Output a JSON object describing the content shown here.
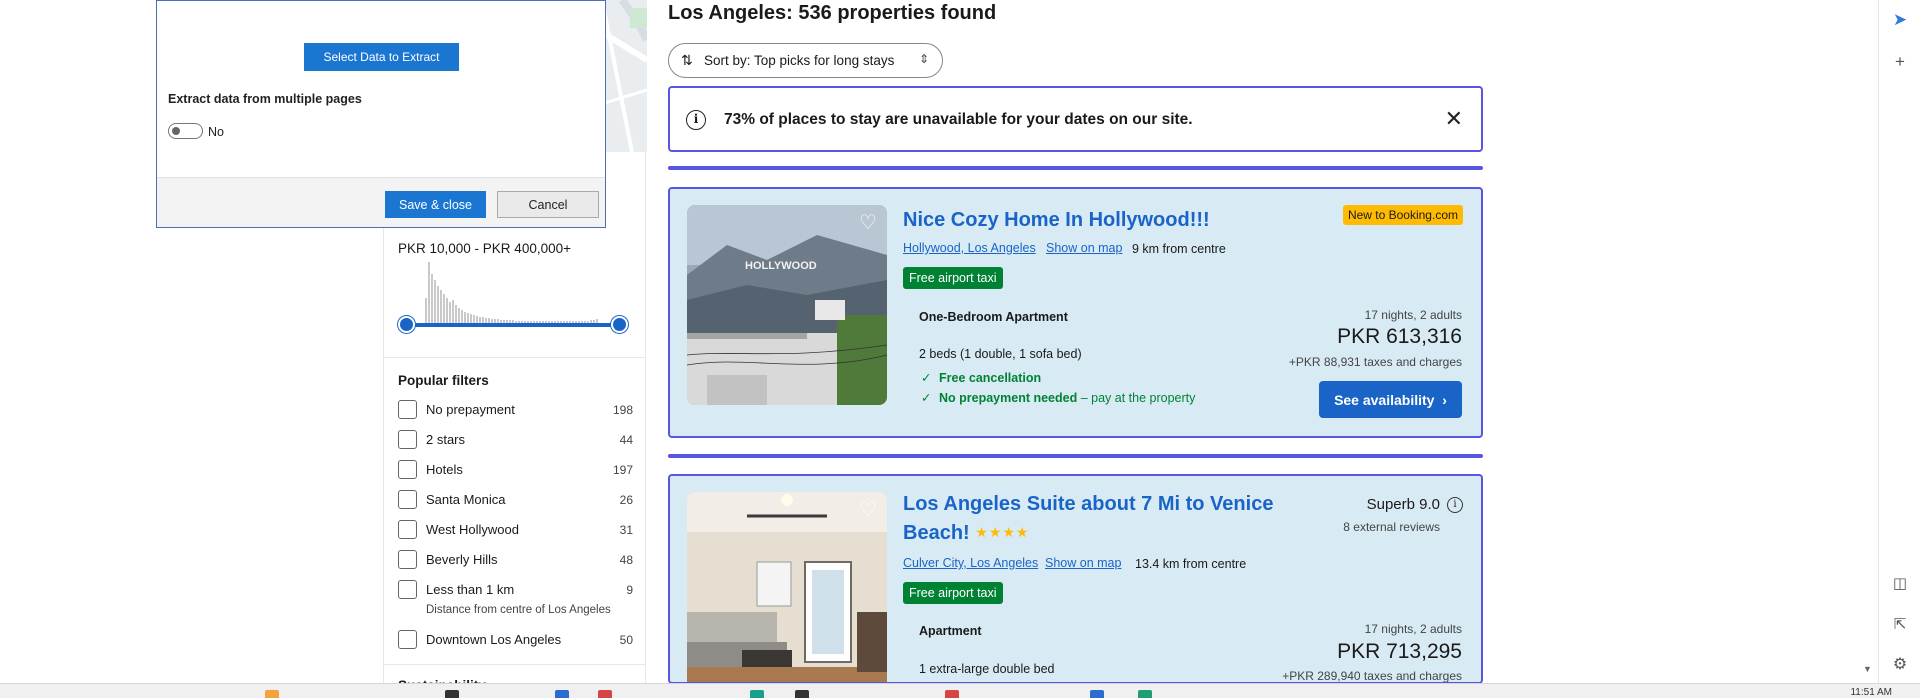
{
  "dialog": {
    "select_button": "Select Data to Extract",
    "multi_page_label": "Extract data from multiple pages",
    "toggle_label": "No",
    "toggle_on": false,
    "save_button": "Save & close",
    "cancel_button": "Cancel"
  },
  "filters": {
    "price_range": "PKR 10,000 - PKR 400,000+",
    "popular_title": "Popular filters",
    "items": [
      {
        "label": "No prepayment",
        "count": "198"
      },
      {
        "label": "2 stars",
        "count": "44"
      },
      {
        "label": "Hotels",
        "count": "197"
      },
      {
        "label": "Santa Monica",
        "count": "26"
      },
      {
        "label": "West Hollywood",
        "count": "31"
      },
      {
        "label": "Beverly Hills",
        "count": "48"
      },
      {
        "label": "Less than 1 km",
        "count": "9",
        "sub": "Distance from centre of Los Angeles"
      },
      {
        "label": "Downtown Los Angeles",
        "count": "50"
      }
    ],
    "next_section_title": "Sustainability"
  },
  "results": {
    "title": "Los Angeles: 536 properties found",
    "sort_label": "Sort by: Top picks for long stays",
    "notice": "73% of places to stay are unavailable for your dates on our site."
  },
  "listings": [
    {
      "name": "Nice Cozy Home In Hollywood!!!",
      "badge": "New to Booking.com",
      "location": "Hollywood, Los Angeles",
      "map_link": "Show on map",
      "distance": "9 km from centre",
      "taxi": "Free airport taxi",
      "unit_type": "One-Bedroom Apartment",
      "beds": "2 beds (1 double, 1 sofa bed)",
      "perk1": "Free cancellation",
      "perk2_bold": "No prepayment needed",
      "perk2_rest": " – pay at the property",
      "stay": "17 nights, 2 adults",
      "price": "PKR 613,316",
      "taxes": "+PKR 88,931 taxes and charges",
      "cta": "See availability"
    },
    {
      "name_line1": "Los Angeles Suite about 7 Mi to Venice",
      "name_line2": "Beach!",
      "stars": "★★★★",
      "score": "Superb 9.0",
      "reviews": "8 external reviews",
      "location": "Culver City, Los Angeles",
      "map_link": "Show on map",
      "distance": "13.4 km from centre",
      "taxi": "Free airport taxi",
      "unit_type": "Apartment",
      "beds": "1 extra-large double bed",
      "stay": "17 nights, 2 adults",
      "price": "PKR 713,295",
      "taxes": "+PKR 289,940 taxes and charges"
    }
  ],
  "system": {
    "clock": "11:51 AM"
  },
  "colors": {
    "accent": "#1a64c8",
    "highlight_border": "#5a55e0",
    "card_bg": "#d8ebf4",
    "green": "#008234",
    "badge": "#febb02"
  }
}
